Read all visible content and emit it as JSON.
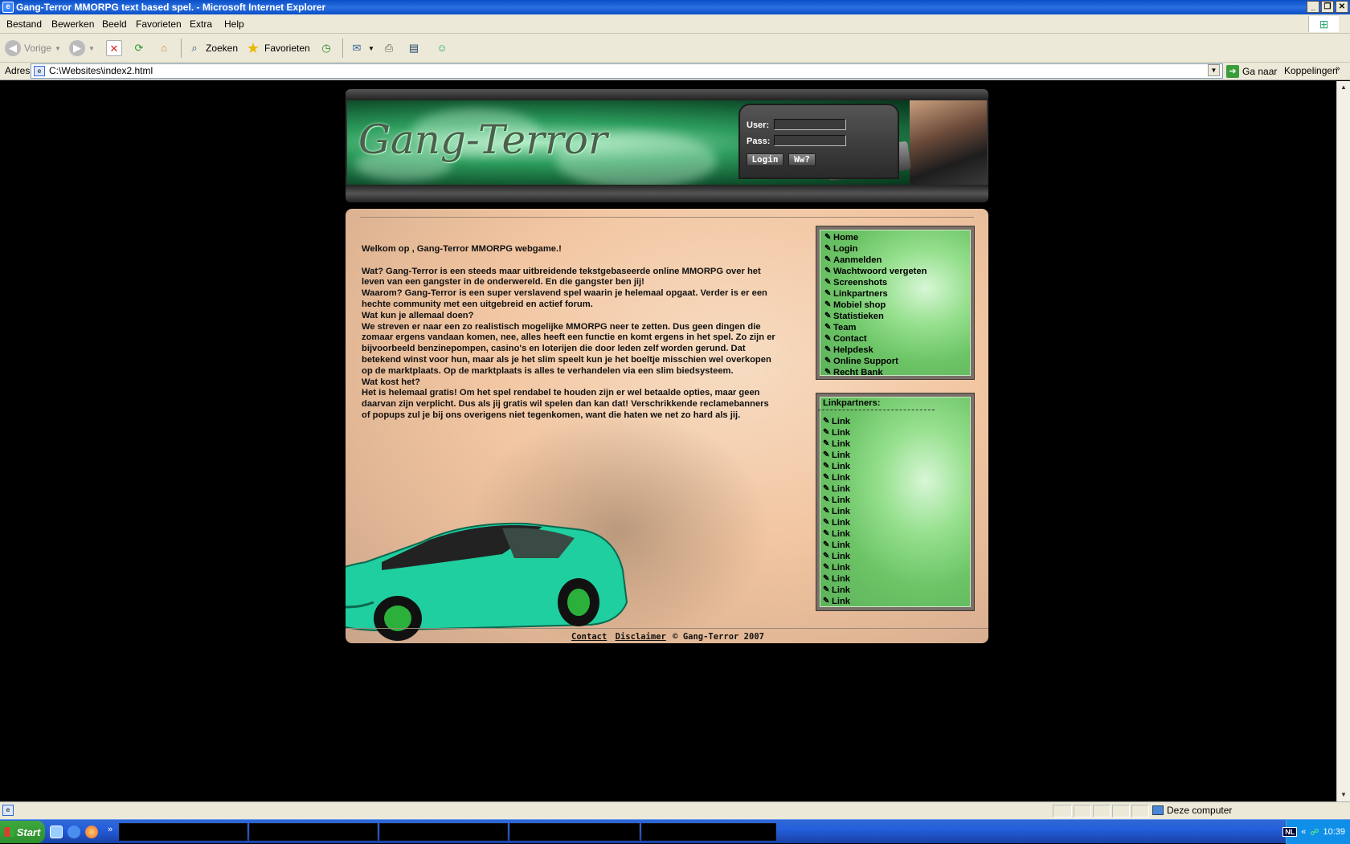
{
  "window": {
    "title": "Gang-Terror MMORPG text based spel. - Microsoft Internet Explorer",
    "controls": [
      "_",
      "❐",
      "✕"
    ]
  },
  "menubar": [
    "Bestand",
    "Bewerken",
    "Beeld",
    "Favorieten",
    "Extra",
    "Help"
  ],
  "toolbar": {
    "back": "Vorige",
    "search": "Zoeken",
    "favorites": "Favorieten"
  },
  "address": {
    "label": "Adres",
    "value": "C:\\Websites\\index2.html",
    "go": "Ga naar",
    "links": "Koppelingen"
  },
  "status": {
    "zone": "Deze computer"
  },
  "taskbar": {
    "start": "Start",
    "clock": "10:39",
    "lang": "NL",
    "chevron": "«"
  },
  "site": {
    "logo": "Gang-Terror",
    "login": {
      "user_label": "User:",
      "pass_label": "Pass:",
      "login_button": "Login",
      "forgot_button": "Ww?"
    },
    "intro": {
      "welcome": "Welkom op , Gang-Terror MMORPG webgame.!",
      "paragraphs": [
        "Wat? Gang-Terror is een steeds maar uitbreidende tekstgebaseerde online MMORPG over het leven van een gangster in de onderwereld. En die gangster ben jij!",
        "Waarom? Gang-Terror is een super verslavend spel waarin je helemaal opgaat. Verder is er een hechte community met een uitgebreid en actief forum.",
        "Wat kun je allemaal doen?",
        "We streven er naar een zo realistisch mogelijke MMORPG neer te zetten. Dus geen dingen die zomaar ergens vandaan komen, nee, alles heeft een functie en komt ergens in het spel. Zo zijn er bijvoorbeeld benzinepompen, casino's en loterijen die door leden zelf worden gerund. Dat betekend winst voor hun, maar als je het slim speelt kun je het boeltje misschien wel overkopen op de marktplaats. Op de marktplaats is alles te verhandelen via een slim biedsysteem.",
        "Wat kost het?",
        "Het is helemaal gratis! Om het spel rendabel te houden zijn er wel betaalde opties, maar geen daarvan zijn verplicht. Dus als jij gratis wil spelen dan kan dat! Verschrikkende reclamebanners of popups zul je bij ons overigens niet tegenkomen, want die haten we net zo hard als jij."
      ]
    },
    "nav": [
      "Home",
      "Login",
      "Aanmelden",
      "Wachtwoord vergeten",
      "Screenshots",
      "Linkpartners",
      "Mobiel shop",
      "Statistieken",
      "Team",
      "Contact",
      "Helpdesk",
      "Online Support",
      "Recht Bank"
    ],
    "linkpartners": {
      "title": "Linkpartners:",
      "items": [
        "Link",
        "Link",
        "Link",
        "Link",
        "Link",
        "Link",
        "Link",
        "Link",
        "Link",
        "Link",
        "Link",
        "Link",
        "Link",
        "Link",
        "Link",
        "Link",
        "Link"
      ]
    },
    "footer": {
      "contact": "Contact",
      "disclaimer": "Disclaimer",
      "copyright": "© Gang-Terror 2007"
    }
  }
}
